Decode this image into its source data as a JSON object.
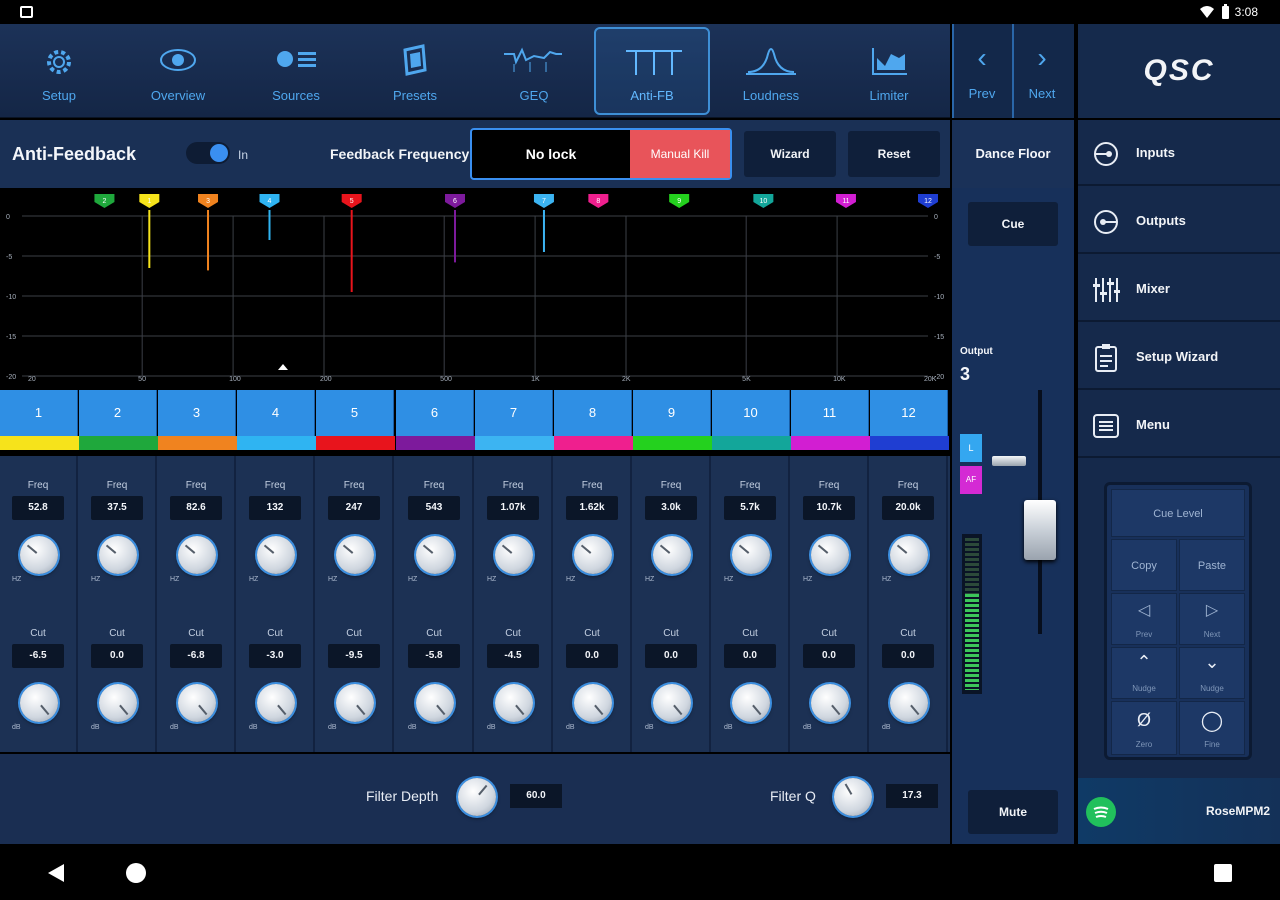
{
  "status_bar": {
    "time": "3:08"
  },
  "nav": {
    "items": [
      {
        "label": "Setup",
        "icon": "gear-icon"
      },
      {
        "label": "Overview",
        "icon": "eye-icon"
      },
      {
        "label": "Sources",
        "icon": "sources-icon"
      },
      {
        "label": "Presets",
        "icon": "presets-icon"
      },
      {
        "label": "GEQ",
        "icon": "geq-icon"
      },
      {
        "label": "Anti-FB",
        "icon": "antifb-icon"
      },
      {
        "label": "Loudness",
        "icon": "loudness-icon"
      },
      {
        "label": "Limiter",
        "icon": "limiter-icon"
      }
    ],
    "active": "Anti-FB",
    "prev": "Prev",
    "next": "Next"
  },
  "brand": {
    "logo": "QSC"
  },
  "antifeedback": {
    "title": "Anti-Feedback",
    "toggle_label": "In",
    "freq_label": "Feedback Frequency",
    "freq_value": "No lock",
    "manual_kill": "Manual Kill",
    "wizard": "Wizard",
    "reset": "Reset"
  },
  "graph": {
    "y_ticks": [
      "0",
      "-5",
      "-10",
      "-15",
      "-20"
    ],
    "x_ticks": [
      "20",
      "50",
      "100",
      "200",
      "500",
      "1K",
      "2K",
      "5K",
      "10K",
      "20K"
    ]
  },
  "channels": [
    {
      "num": "1",
      "color": "#f6e31b",
      "freq_label": "Freq",
      "freq": "52.8",
      "freq_unit": "HZ",
      "cut_label": "Cut",
      "cut": "-6.5",
      "cut_unit": "dB"
    },
    {
      "num": "2",
      "color": "#1fa83c",
      "freq_label": "Freq",
      "freq": "37.5",
      "freq_unit": "HZ",
      "cut_label": "Cut",
      "cut": "0.0",
      "cut_unit": "dB"
    },
    {
      "num": "3",
      "color": "#f0831f",
      "freq_label": "Freq",
      "freq": "82.6",
      "freq_unit": "HZ",
      "cut_label": "Cut",
      "cut": "-6.8",
      "cut_unit": "dB"
    },
    {
      "num": "4",
      "color": "#2fb4f2",
      "freq_label": "Freq",
      "freq": "132",
      "freq_unit": "HZ",
      "cut_label": "Cut",
      "cut": "-3.0",
      "cut_unit": "dB"
    },
    {
      "num": "5",
      "color": "#e8141c",
      "freq_label": "Freq",
      "freq": "247",
      "freq_unit": "HZ",
      "cut_label": "Cut",
      "cut": "-9.5",
      "cut_unit": "dB"
    },
    {
      "num": "6",
      "color": "#7d1a9c",
      "freq_label": "Freq",
      "freq": "543",
      "freq_unit": "HZ",
      "cut_label": "Cut",
      "cut": "-5.8",
      "cut_unit": "dB"
    },
    {
      "num": "7",
      "color": "#3cb4f2",
      "freq_label": "Freq",
      "freq": "1.07k",
      "freq_unit": "HZ",
      "cut_label": "Cut",
      "cut": "-4.5",
      "cut_unit": "dB"
    },
    {
      "num": "8",
      "color": "#ef1f8e",
      "freq_label": "Freq",
      "freq": "1.62k",
      "freq_unit": "HZ",
      "cut_label": "Cut",
      "cut": "0.0",
      "cut_unit": "dB"
    },
    {
      "num": "9",
      "color": "#24d11e",
      "freq_label": "Freq",
      "freq": "3.0k",
      "freq_unit": "HZ",
      "cut_label": "Cut",
      "cut": "0.0",
      "cut_unit": "dB"
    },
    {
      "num": "10",
      "color": "#13a69a",
      "freq_label": "Freq",
      "freq": "5.7k",
      "freq_unit": "HZ",
      "cut_label": "Cut",
      "cut": "0.0",
      "cut_unit": "dB"
    },
    {
      "num": "11",
      "color": "#d21ed2",
      "freq_label": "Freq",
      "freq": "10.7k",
      "freq_unit": "HZ",
      "cut_label": "Cut",
      "cut": "0.0",
      "cut_unit": "dB"
    },
    {
      "num": "12",
      "color": "#1f3ed2",
      "freq_label": "Freq",
      "freq": "20.0k",
      "freq_unit": "HZ",
      "cut_label": "Cut",
      "cut": "0.0",
      "cut_unit": "dB"
    }
  ],
  "bottom": {
    "filter_depth_label": "Filter Depth",
    "filter_depth_value": "60.0",
    "filter_q_label": "Filter Q",
    "filter_q_value": "17.3"
  },
  "output": {
    "zone": "Dance Floor",
    "cue": "Cue",
    "label": "Output",
    "number": "3",
    "tag_l": "L",
    "tag_af": "AF",
    "mute": "Mute"
  },
  "sidebar": {
    "items": [
      {
        "label": "Inputs",
        "icon": "inputs-icon"
      },
      {
        "label": "Outputs",
        "icon": "outputs-icon"
      },
      {
        "label": "Mixer",
        "icon": "mixer-icon"
      },
      {
        "label": "Setup Wizard",
        "icon": "wizard-icon"
      },
      {
        "label": "Menu",
        "icon": "menu-icon"
      }
    ],
    "cuepad": {
      "cue_level": "Cue Level",
      "copy": "Copy",
      "paste": "Paste",
      "prev": "Prev",
      "next": "Next",
      "nudge_up": "Nudge",
      "nudge_down": "Nudge",
      "zero": "Zero",
      "fine": "Fine"
    },
    "source_name": "RoseMPM2"
  }
}
